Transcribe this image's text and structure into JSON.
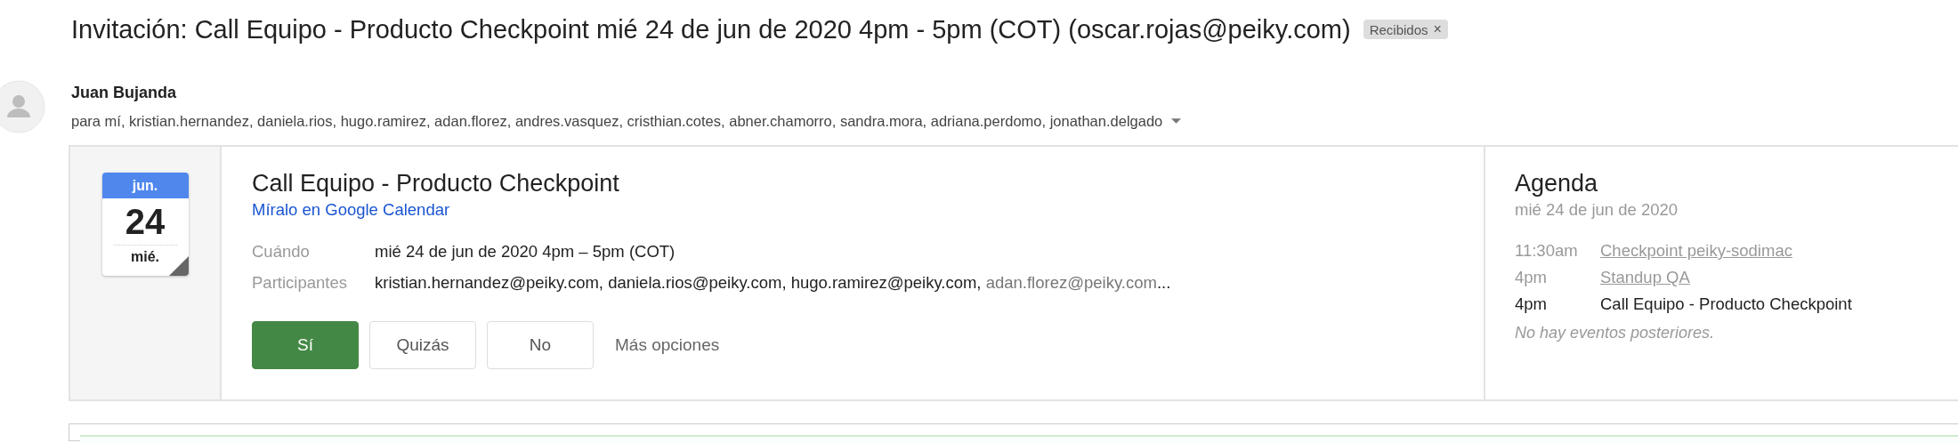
{
  "subject": "Invitación: Call Equipo - Producto Checkpoint mié 24 de jun de 2020 4pm - 5pm (COT) (oscar.rojas@peiky.com)",
  "label": {
    "text": "Recibidos",
    "remove": "×"
  },
  "sender": {
    "name": "Juan Bujanda",
    "recipients": "para mí, kristian.hernandez, daniela.rios, hugo.ramirez, adan.florez, andres.vasquez, cristhian.cotes, abner.chamorro, sandra.mora, adriana.perdomo, jonathan.delgado"
  },
  "invite": {
    "calendar": {
      "month": "jun.",
      "day": "24",
      "weekday": "mié."
    },
    "title": "Call Equipo - Producto Checkpoint",
    "link": "Míralo en Google Calendar",
    "when": {
      "label": "Cuándo",
      "value": "mié 24 de jun de 2020 4pm – 5pm (COT)"
    },
    "participants": {
      "label": "Participantes",
      "parts": [
        {
          "text": "kristian.hernandez@peiky.com, daniela.rios@peiky.com, hugo.ramirez@peiky.com, ",
          "faded": false
        },
        {
          "text": "adan.florez@peiky.com",
          "faded": true
        },
        {
          "text": "...",
          "faded": false
        }
      ]
    },
    "buttons": [
      {
        "label": "Sí",
        "selected": true
      },
      {
        "label": "Quizás",
        "selected": false
      },
      {
        "label": "No",
        "selected": false
      }
    ],
    "more": "Más opciones"
  },
  "agenda": {
    "title": "Agenda",
    "date": "mié 24 de jun de 2020",
    "events": [
      {
        "time": "11:30am",
        "title": "Checkpoint peiky-sodimac",
        "kind": "link"
      },
      {
        "time": "4pm",
        "title": "Standup QA",
        "kind": "link"
      },
      {
        "time": "4pm",
        "title": "Call Equipo - Producto Checkpoint",
        "kind": "current"
      }
    ],
    "note": "No hay eventos posteriores."
  }
}
